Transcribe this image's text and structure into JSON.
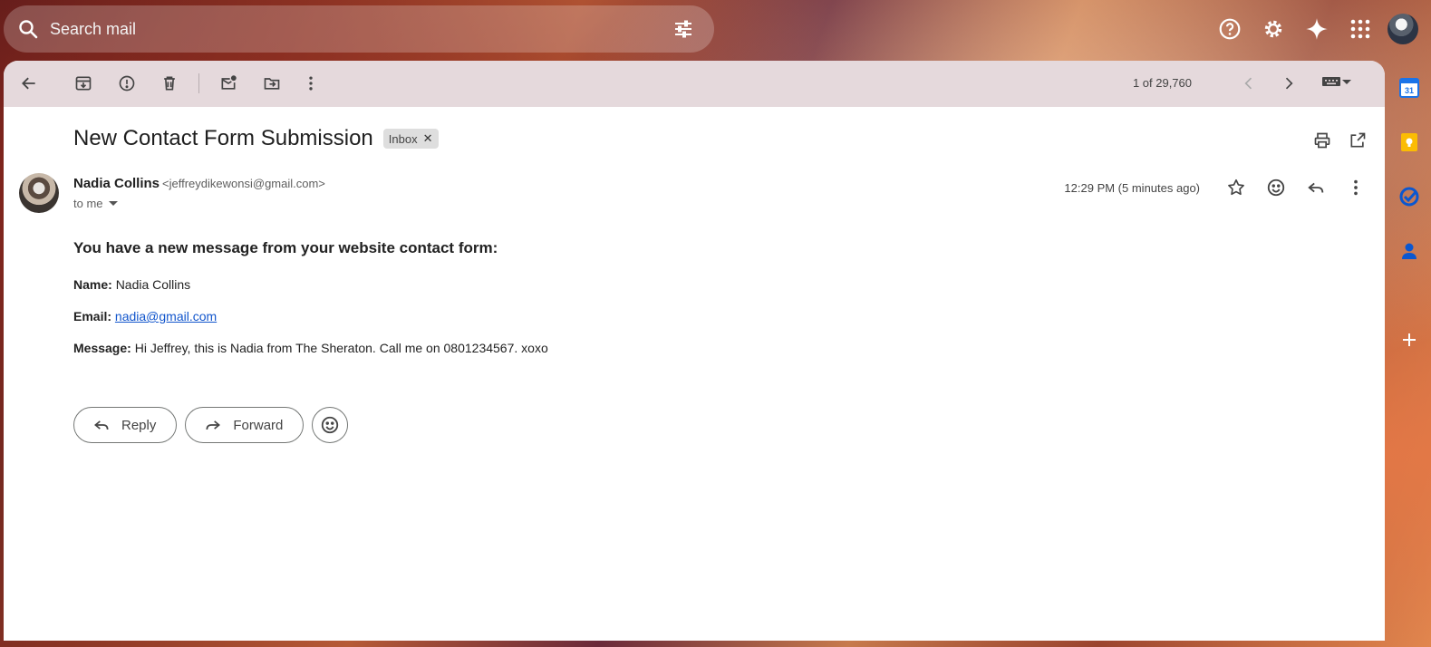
{
  "search": {
    "placeholder": "Search mail"
  },
  "toolbar": {
    "pager": "1 of 29,760"
  },
  "email": {
    "subject": "New Contact Form Submission",
    "label": "Inbox",
    "sender_name": "Nadia Collins",
    "sender_email": "<jeffreydikewonsi@gmail.com>",
    "recipient": "to me",
    "timestamp": "12:29 PM (5 minutes ago)",
    "body": {
      "heading": "You have a new message from your website contact form:",
      "name_label": "Name:",
      "name_value": "Nadia Collins",
      "email_label": "Email:",
      "email_value": "nadia@gmail.com",
      "message_label": "Message:",
      "message_value": "Hi Jeffrey, this is Nadia from The Sheraton. Call me on 0801234567. xoxo"
    }
  },
  "actions": {
    "reply_label": "Reply",
    "forward_label": "Forward"
  },
  "side_panel": {
    "calendar_day": "31"
  },
  "icons": {
    "top": [
      "help-icon",
      "settings-icon",
      "gemini-icon",
      "apps-icon"
    ],
    "toolbar": [
      "back-icon",
      "archive-icon",
      "report-spam-icon",
      "delete-icon",
      "mark-unread-icon",
      "move-to-icon",
      "more-icon",
      "chevron-left-icon",
      "chevron-right-icon",
      "keyboard-icon"
    ],
    "message": [
      "star-icon",
      "emoji-icon",
      "reply-icon",
      "more-vert-icon"
    ]
  },
  "colors": {
    "toolbar_bg": "#e5d9dc",
    "link": "#1155cc",
    "calendar_blue": "#1a73e8",
    "keep_yellow": "#fbbc04",
    "tasks_blue": "#0b57d0"
  }
}
